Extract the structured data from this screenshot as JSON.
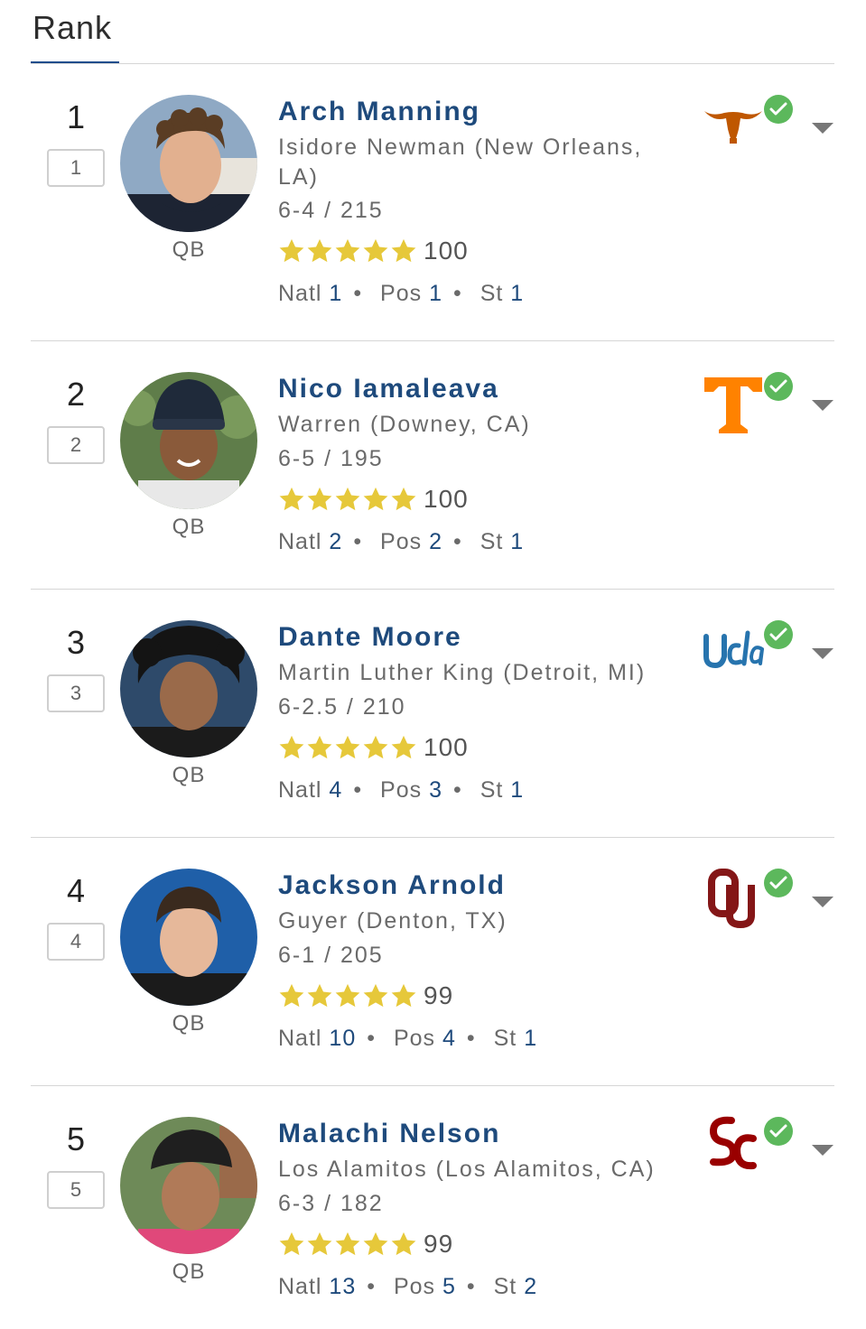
{
  "header": {
    "title": "Rank"
  },
  "players": [
    {
      "rank": "1",
      "rank_box": "1",
      "name": "Arch Manning",
      "school": "Isidore Newman (New Orleans, LA)",
      "hw": "6-4 / 215",
      "score": "100",
      "stars": 5,
      "position": "QB",
      "natl_label": "Natl",
      "natl": "1",
      "pos_label": "Pos",
      "pos_rank": "1",
      "st_label": "St",
      "st": "1",
      "school_logo": "texas-longhorn-logo",
      "commit_icon": "check-icon"
    },
    {
      "rank": "2",
      "rank_box": "2",
      "name": "Nico Iamaleava",
      "school": "Warren (Downey, CA)",
      "hw": "6-5 / 195",
      "score": "100",
      "stars": 5,
      "position": "QB",
      "natl_label": "Natl",
      "natl": "2",
      "pos_label": "Pos",
      "pos_rank": "2",
      "st_label": "St",
      "st": "1",
      "school_logo": "tennessee-t-logo",
      "commit_icon": "check-icon"
    },
    {
      "rank": "3",
      "rank_box": "3",
      "name": "Dante Moore",
      "school": "Martin Luther King (Detroit, MI)",
      "hw": "6-2.5 / 210",
      "score": "100",
      "stars": 5,
      "position": "QB",
      "natl_label": "Natl",
      "natl": "4",
      "pos_label": "Pos",
      "pos_rank": "3",
      "st_label": "St",
      "st": "1",
      "school_logo": "ucla-script-logo",
      "commit_icon": "check-icon"
    },
    {
      "rank": "4",
      "rank_box": "4",
      "name": "Jackson Arnold",
      "school": "Guyer (Denton, TX)",
      "hw": "6-1 / 205",
      "score": "99",
      "stars": 5,
      "position": "QB",
      "natl_label": "Natl",
      "natl": "10",
      "pos_label": "Pos",
      "pos_rank": "4",
      "st_label": "St",
      "st": "1",
      "school_logo": "oklahoma-ou-logo",
      "commit_icon": "check-icon"
    },
    {
      "rank": "5",
      "rank_box": "5",
      "name": "Malachi Nelson",
      "school": "Los Alamitos (Los Alamitos, CA)",
      "hw": "6-3 / 182",
      "score": "99",
      "stars": 5,
      "position": "QB",
      "natl_label": "Natl",
      "natl": "13",
      "pos_label": "Pos",
      "pos_rank": "5",
      "st_label": "St",
      "st": "2",
      "school_logo": "usc-sc-logo",
      "commit_icon": "check-icon"
    }
  ],
  "colors": {
    "name_blue": "#1e4a7c",
    "star_gold": "#e6c83a",
    "check_green": "#5cb85c",
    "texas_orange": "#bf5700",
    "tennessee_orange": "#ff8200",
    "ucla_blue": "#2774ae",
    "ou_crimson": "#841617",
    "usc_cardinal": "#990000"
  }
}
